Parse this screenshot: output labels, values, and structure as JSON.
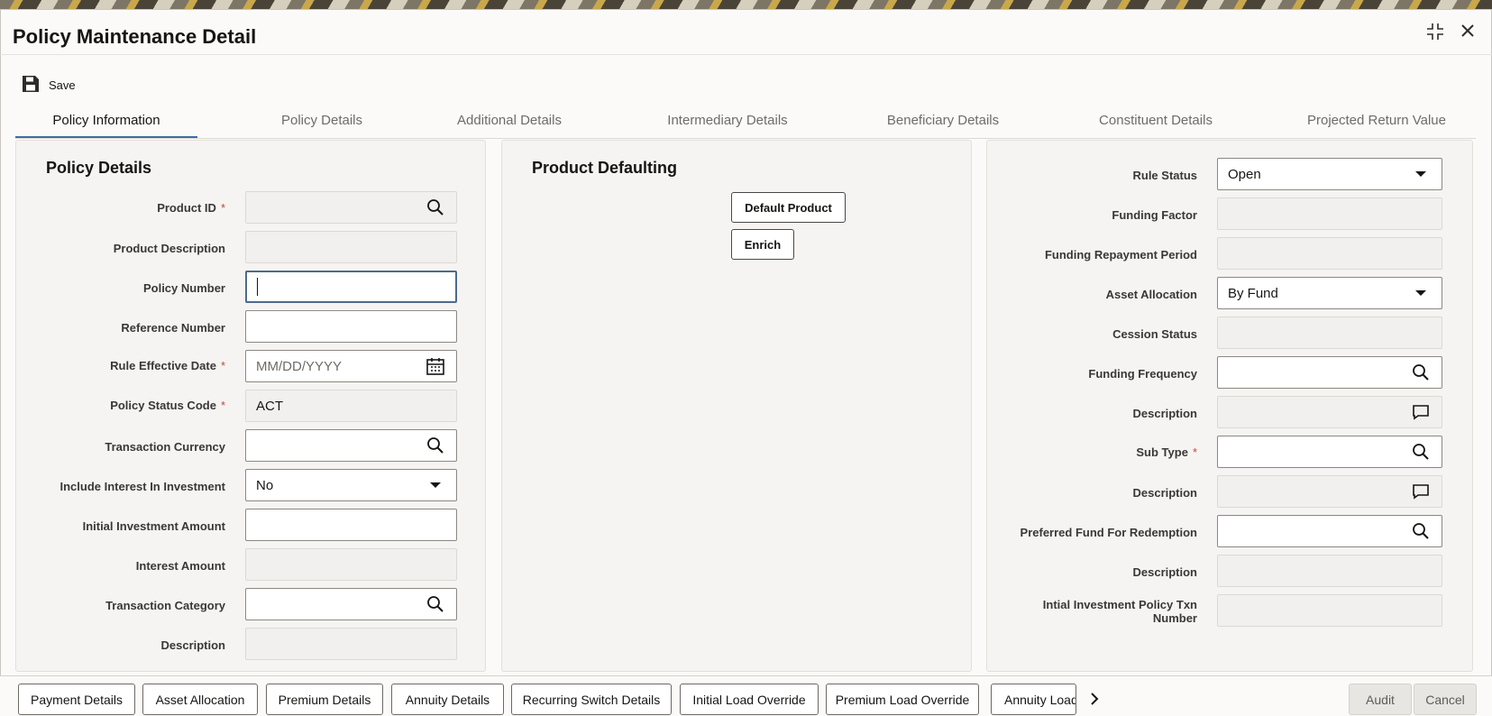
{
  "window": {
    "title": "Policy Maintenance Detail"
  },
  "toolbar": {
    "save_label": "Save"
  },
  "tabs": [
    {
      "label": "Policy Information",
      "active": true
    },
    {
      "label": "Policy Details",
      "active": false
    },
    {
      "label": "Additional Details",
      "active": false
    },
    {
      "label": "Intermediary Details",
      "active": false
    },
    {
      "label": "Beneficiary Details",
      "active": false
    },
    {
      "label": "Constituent Details",
      "active": false
    },
    {
      "label": "Projected Return Value",
      "active": false
    }
  ],
  "policy_details": {
    "title": "Policy Details",
    "fields": [
      {
        "label": "Product ID",
        "required": true,
        "value": "",
        "icon": "search-icon"
      },
      {
        "label": "Product Description",
        "required": false,
        "value": ""
      },
      {
        "label": "Policy Number",
        "required": false,
        "value": ""
      },
      {
        "label": "Reference Number",
        "required": false,
        "value": ""
      },
      {
        "label": "Rule Effective Date",
        "required": true,
        "placeholder": "MM/DD/YYYY",
        "icon": "calendar-icon"
      },
      {
        "label": "Policy Status Code",
        "required": true,
        "value": "ACT"
      },
      {
        "label": "Transaction Currency",
        "required": false,
        "value": "",
        "icon": "search-icon"
      },
      {
        "label": "Include Interest In Investment",
        "required": false,
        "value": "No",
        "icon": "dropdown-icon"
      },
      {
        "label": "Initial Investment Amount",
        "required": false,
        "value": ""
      },
      {
        "label": "Interest Amount",
        "required": false,
        "value": ""
      },
      {
        "label": "Transaction Category",
        "required": false,
        "value": "",
        "icon": "search-icon"
      },
      {
        "label": "Description",
        "required": false,
        "value": ""
      }
    ]
  },
  "product_defaulting": {
    "title": "Product Defaulting",
    "default_product_label": "Default Product",
    "enrich_label": "Enrich"
  },
  "right_panel": {
    "fields": [
      {
        "label": "Rule Status",
        "required": false,
        "value": "Open",
        "icon": "dropdown-icon"
      },
      {
        "label": "Funding Factor",
        "required": false,
        "value": ""
      },
      {
        "label": "Funding Repayment Period",
        "required": false,
        "value": ""
      },
      {
        "label": "Asset Allocation",
        "required": false,
        "value": "By Fund",
        "icon": "dropdown-icon"
      },
      {
        "label": "Cession Status",
        "required": false,
        "value": ""
      },
      {
        "label": "Funding Frequency",
        "required": false,
        "value": "",
        "icon": "search-icon"
      },
      {
        "label": "Description",
        "required": false,
        "value": "",
        "icon": "comment-icon"
      },
      {
        "label": "Sub Type",
        "required": true,
        "value": "",
        "icon": "search-icon"
      },
      {
        "label": "Description",
        "required": false,
        "value": "",
        "icon": "comment-icon"
      },
      {
        "label": "Preferred Fund For Redemption",
        "required": false,
        "value": "",
        "icon": "search-icon"
      },
      {
        "label": "Description",
        "required": false,
        "value": ""
      },
      {
        "label_line1": "Intial Investment Policy Txn",
        "label_line2": "Number",
        "required": false,
        "value": ""
      }
    ]
  },
  "footer": {
    "buttons": [
      "Payment Details",
      "Asset Allocation",
      "Premium Details",
      "Annuity Details",
      "Recurring Switch Details",
      "Initial Load Override",
      "Premium Load Override",
      "Annuity Load"
    ],
    "audit_label": "Audit",
    "cancel_label": "Cancel"
  }
}
